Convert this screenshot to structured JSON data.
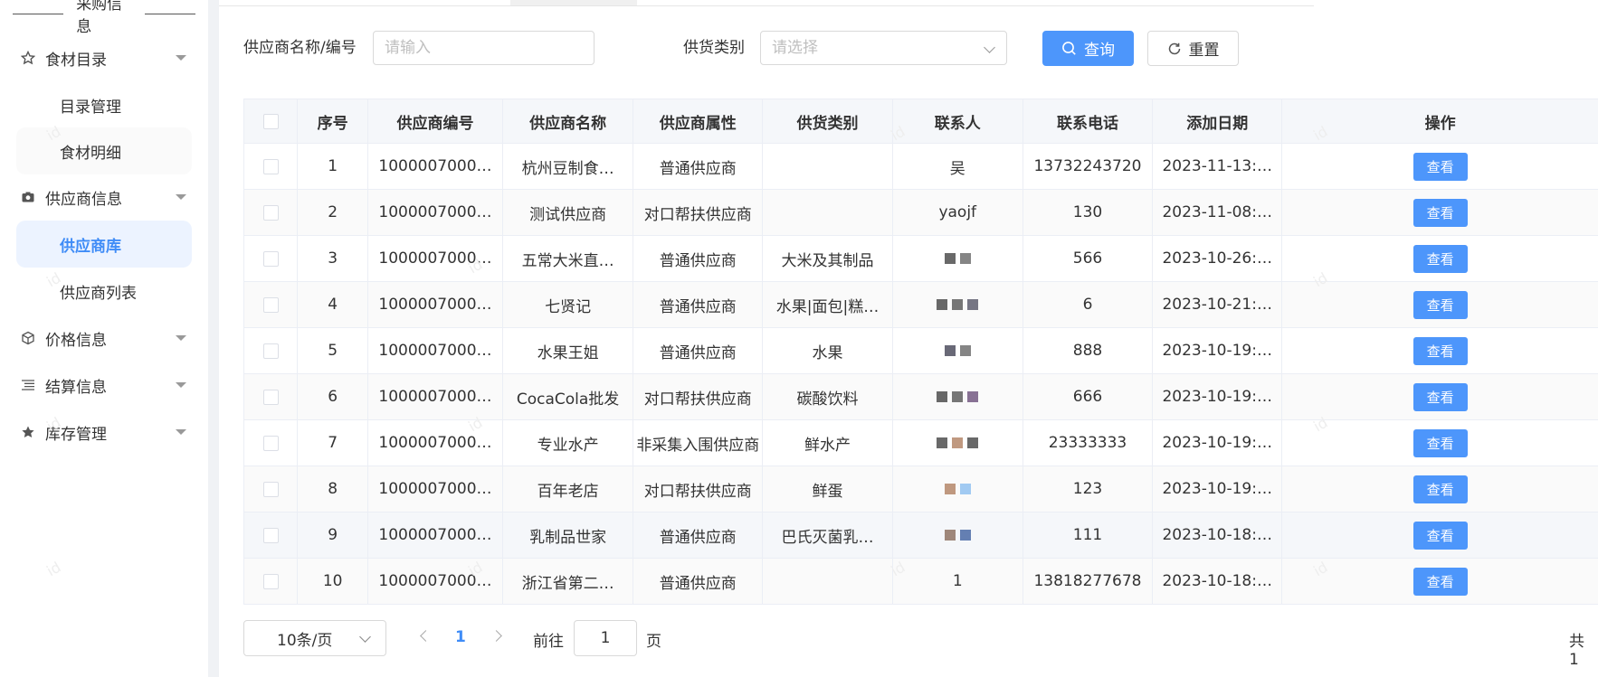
{
  "sidebar": {
    "section_title": "采购信息",
    "items": [
      {
        "label": "食材目录",
        "icon": "star-outline-icon"
      },
      {
        "label": "目录管理"
      },
      {
        "label": "食材明细"
      },
      {
        "label": "供应商信息",
        "icon": "camera-icon"
      },
      {
        "label": "供应商库"
      },
      {
        "label": "供应商列表"
      },
      {
        "label": "价格信息",
        "icon": "cube-icon"
      },
      {
        "label": "结算信息",
        "icon": "list-icon"
      },
      {
        "label": "库存管理",
        "icon": "star-icon"
      }
    ]
  },
  "filters": {
    "name_label": "供应商名称/编号",
    "name_placeholder": "请输入",
    "category_label": "供货类别",
    "category_placeholder": "请选择",
    "query_label": "查询",
    "reset_label": "重置"
  },
  "table": {
    "columns": [
      "序号",
      "供应商编号",
      "供应商名称",
      "供应商属性",
      "供货类别",
      "联系人",
      "联系电话",
      "添加日期",
      "操作"
    ],
    "action_label": "查看",
    "rows": [
      {
        "no": "1",
        "code": "1000007000…",
        "name": "杭州豆制食…",
        "attr": "普通供应商",
        "category": "",
        "contact": "吴",
        "phone": "13732243720",
        "date": "2023-11-13:…"
      },
      {
        "no": "2",
        "code": "1000007000…",
        "name": "测试供应商",
        "attr": "对口帮扶供应商",
        "category": "",
        "contact": "yaojf",
        "phone": "130",
        "date": "2023-11-08:…"
      },
      {
        "no": "3",
        "code": "1000007000…",
        "name": "五常大米直…",
        "attr": "普通供应商",
        "category": "大米及其制品",
        "contact": "",
        "phone": "566",
        "date": "2023-10-26:…"
      },
      {
        "no": "4",
        "code": "1000007000…",
        "name": "七贤记",
        "attr": "普通供应商",
        "category": "水果|面包|糕…",
        "contact": "",
        "phone": "6",
        "date": "2023-10-21:…"
      },
      {
        "no": "5",
        "code": "1000007000…",
        "name": "水果王姐",
        "attr": "普通供应商",
        "category": "水果",
        "contact": "",
        "phone": "888",
        "date": "2023-10-19:…"
      },
      {
        "no": "6",
        "code": "1000007000…",
        "name": "CocaCola批发",
        "attr": "对口帮扶供应商",
        "category": "碳酸饮料",
        "contact": "",
        "phone": "666",
        "date": "2023-10-19:…"
      },
      {
        "no": "7",
        "code": "1000007000…",
        "name": "专业水产",
        "attr": "非采集入围供应商",
        "category": "鲜水产",
        "contact": "",
        "phone": "23333333",
        "date": "2023-10-19:…"
      },
      {
        "no": "8",
        "code": "1000007000…",
        "name": "百年老店",
        "attr": "对口帮扶供应商",
        "category": "鲜蛋",
        "contact": "",
        "phone": "123",
        "date": "2023-10-19:…"
      },
      {
        "no": "9",
        "code": "1000007000…",
        "name": "乳制品世家",
        "attr": "普通供应商",
        "category": "巴氏灭菌乳…",
        "contact": "",
        "phone": "111",
        "date": "2023-10-18:…"
      },
      {
        "no": "10",
        "code": "1000007000…",
        "name": "浙江省第二…",
        "attr": "普通供应商",
        "category": "",
        "contact": "1",
        "phone": "13818277678",
        "date": "2023-10-18:…"
      }
    ]
  },
  "pagination": {
    "page_size": "10条/页",
    "current_page": "1",
    "goto_prefix": "前往",
    "goto_value": "1",
    "goto_suffix": "页",
    "total_prefix": "共 1"
  },
  "watermark": "id",
  "colors": {
    "primary": "#4d96fb",
    "active_bg": "#ecf3ff",
    "active_text": "#3f8cf7"
  }
}
